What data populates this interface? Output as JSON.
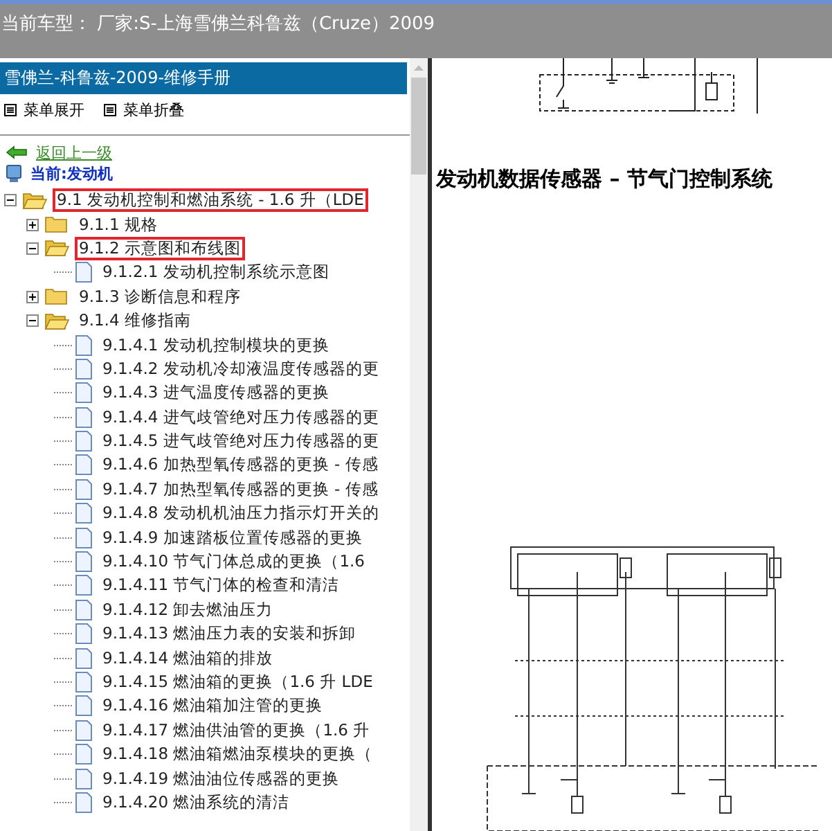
{
  "header": {
    "title": "当前车型： 厂家:S-上海雪佛兰科鲁兹（Cruze）2009"
  },
  "sidebar": {
    "title": "雪佛兰-科鲁兹-2009-维修手册",
    "menu": [
      {
        "label": "菜单展开"
      },
      {
        "label": "菜单折叠"
      }
    ],
    "back_link": "返回上一级",
    "current": "当前:发动机",
    "tree": [
      {
        "kind": "folder",
        "label": "9.1 发动机控制和燃油系统 - 1.6 升（LDE",
        "expanded": true,
        "highlighted": true,
        "children": [
          {
            "kind": "folder",
            "label": "9.1.1 规格",
            "expanded": false,
            "highlighted": false
          },
          {
            "kind": "folder",
            "label": "9.1.2 示意图和布线图",
            "expanded": true,
            "highlighted": true,
            "children": [
              {
                "kind": "page",
                "label": "9.1.2.1 发动机控制系统示意图"
              }
            ]
          },
          {
            "kind": "folder",
            "label": "9.1.3 诊断信息和程序",
            "expanded": false,
            "highlighted": false
          },
          {
            "kind": "folder",
            "label": "9.1.4 维修指南",
            "expanded": true,
            "highlighted": false,
            "children": [
              {
                "kind": "page",
                "label": "9.1.4.1 发动机控制模块的更换"
              },
              {
                "kind": "page",
                "label": "9.1.4.2 发动机冷却液温度传感器的更"
              },
              {
                "kind": "page",
                "label": "9.1.4.3 进气温度传感器的更换"
              },
              {
                "kind": "page",
                "label": "9.1.4.4 进气歧管绝对压力传感器的更"
              },
              {
                "kind": "page",
                "label": "9.1.4.5 进气歧管绝对压力传感器的更"
              },
              {
                "kind": "page",
                "label": "9.1.4.6 加热型氧传感器的更换 - 传感"
              },
              {
                "kind": "page",
                "label": "9.1.4.7 加热型氧传感器的更换 - 传感"
              },
              {
                "kind": "page",
                "label": "9.1.4.8 发动机机油压力指示灯开关的"
              },
              {
                "kind": "page",
                "label": "9.1.4.9 加速踏板位置传感器的更换"
              },
              {
                "kind": "page",
                "label": "9.1.4.10 节气门体总成的更换（1.6"
              },
              {
                "kind": "page",
                "label": "9.1.4.11 节气门体的检查和清洁"
              },
              {
                "kind": "page",
                "label": "9.1.4.12 卸去燃油压力"
              },
              {
                "kind": "page",
                "label": "9.1.4.13 燃油压力表的安装和拆卸"
              },
              {
                "kind": "page",
                "label": "9.1.4.14 燃油箱的排放"
              },
              {
                "kind": "page",
                "label": "9.1.4.15 燃油箱的更换（1.6 升 LDE"
              },
              {
                "kind": "page",
                "label": "9.1.4.16 燃油箱加注管的更换"
              },
              {
                "kind": "page",
                "label": "9.1.4.17 燃油供油管的更换（1.6 升"
              },
              {
                "kind": "page",
                "label": "9.1.4.18 燃油箱燃油泵模块的更换（"
              },
              {
                "kind": "page",
                "label": "9.1.4.19 燃油油位传感器的更换"
              },
              {
                "kind": "page",
                "label": "9.1.4.20 燃油系统的清洁"
              }
            ]
          }
        ]
      }
    ]
  },
  "content": {
    "heading": "发动机数据传感器 – 节气门控制系统"
  }
}
